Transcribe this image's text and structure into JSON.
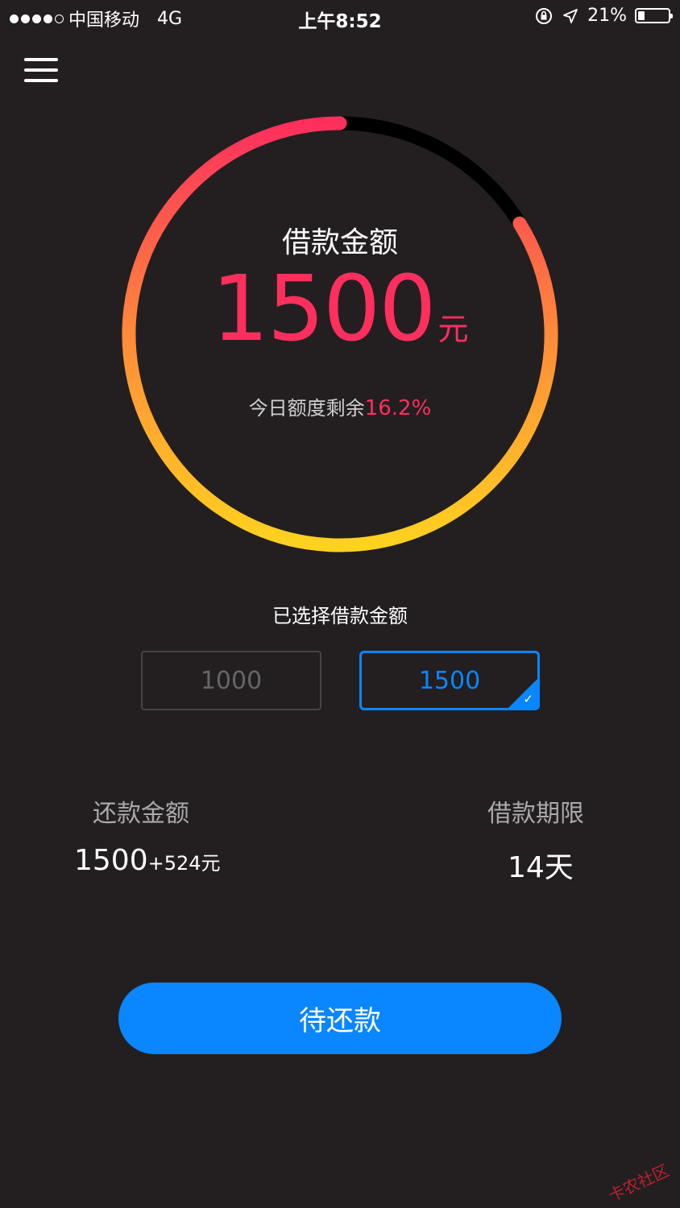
{
  "status_bar": {
    "carrier": "中国移动",
    "network": "4G",
    "time": "上午8:52",
    "battery": "21%",
    "signal_bars_filled": 4,
    "signal_bars_total": 5,
    "battery_level": 0.21
  },
  "gauge": {
    "title": "借款金额",
    "amount": "1500",
    "unit": "元",
    "remaining_label": "今日额度剩余",
    "remaining_value": "16.2%",
    "remaining_fraction": 0.162,
    "colors": {
      "start": "#ff2f5d",
      "mid": "#ff8a3a",
      "end": "#ffd21f",
      "track": "#000000"
    }
  },
  "selection": {
    "label": "已选择借款金额",
    "options": [
      {
        "value": "1000",
        "selected": false
      },
      {
        "value": "1500",
        "selected": true
      }
    ]
  },
  "repayment": {
    "label": "还款金额",
    "principal": "1500",
    "interest": "+524元"
  },
  "term": {
    "label": "借款期限",
    "value": "14天"
  },
  "cta": {
    "label": "待还款"
  },
  "watermark": "卡农社区",
  "icons": {
    "menu": "hamburger-icon",
    "lock": "rotation-lock-icon",
    "location": "location-arrow-icon"
  },
  "colors": {
    "background": "#231f20",
    "accent": "#0a86ff",
    "highlight": "#ff2f5d"
  }
}
